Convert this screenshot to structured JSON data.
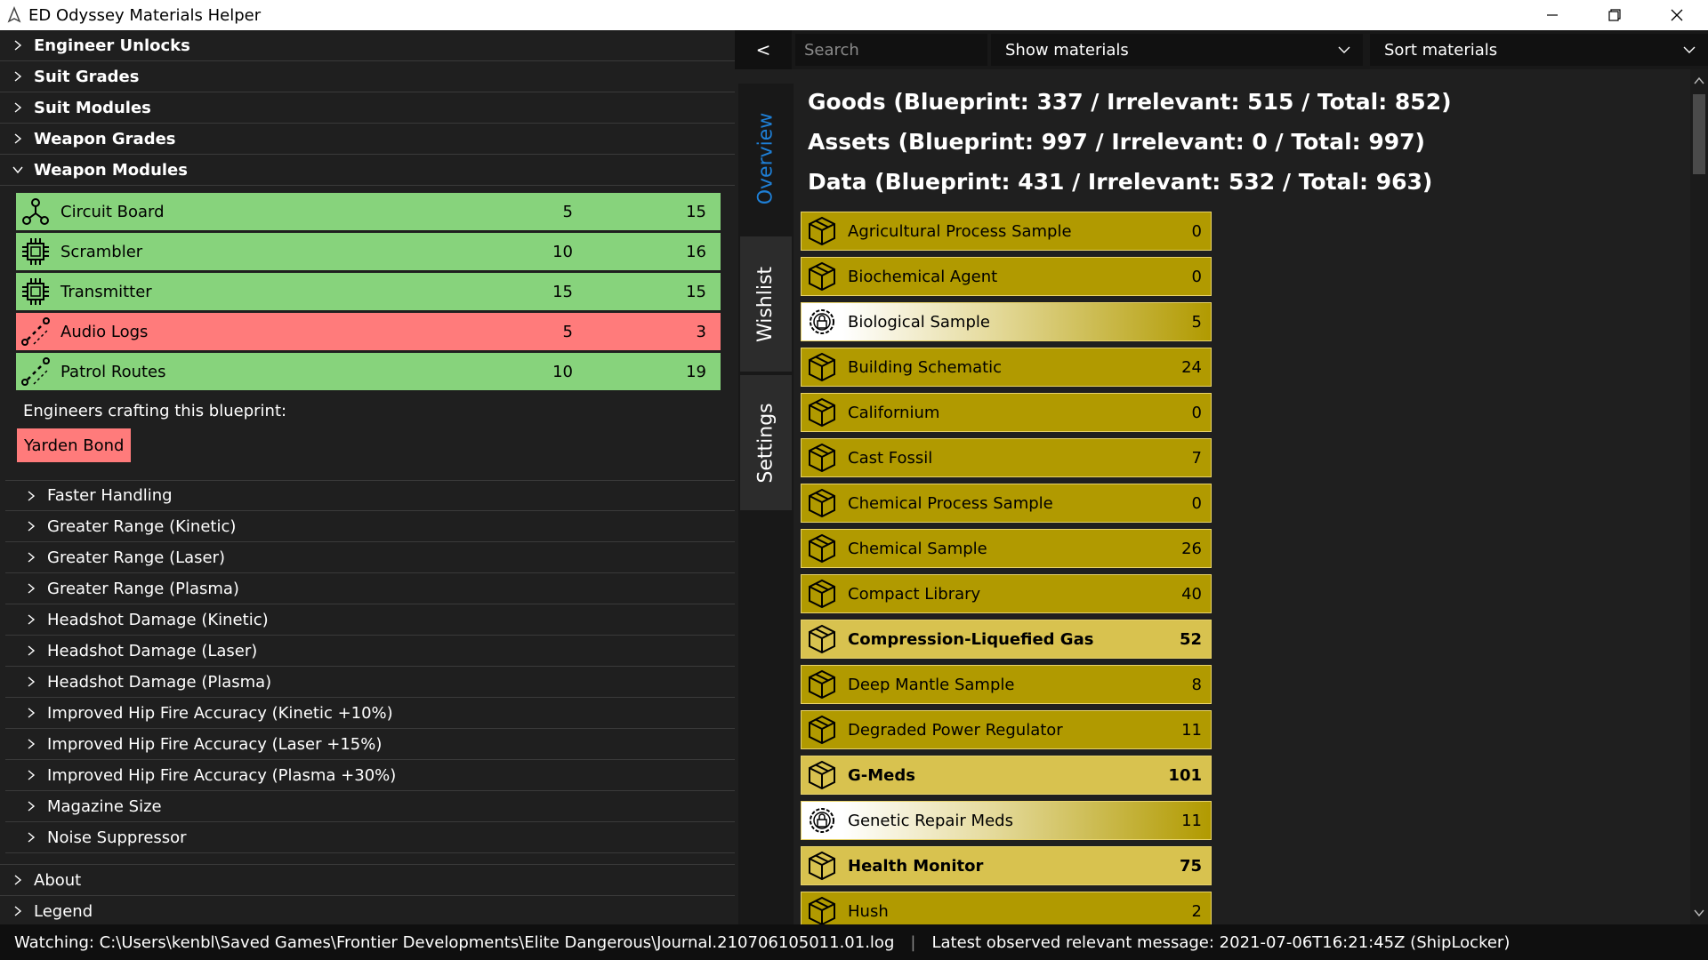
{
  "window": {
    "title": "ED Odyssey Materials Helper"
  },
  "left_panel": {
    "sections": [
      {
        "label": "Engineer Unlocks",
        "expanded": false
      },
      {
        "label": "Suit Grades",
        "expanded": false
      },
      {
        "label": "Suit Modules",
        "expanded": false
      },
      {
        "label": "Weapon Grades",
        "expanded": false
      },
      {
        "label": "Weapon Modules",
        "expanded": true
      }
    ],
    "blueprint_materials": [
      {
        "name": "Circuit Board",
        "icon": "circuit-icon",
        "required": "5",
        "owned": "15",
        "status": "ok"
      },
      {
        "name": "Scrambler",
        "icon": "chip-icon",
        "required": "10",
        "owned": "16",
        "status": "ok"
      },
      {
        "name": "Transmitter",
        "icon": "chip-icon",
        "required": "15",
        "owned": "15",
        "status": "ok"
      },
      {
        "name": "Audio Logs",
        "icon": "data-icon",
        "required": "5",
        "owned": "3",
        "status": "missing"
      },
      {
        "name": "Patrol Routes",
        "icon": "data-icon",
        "required": "10",
        "owned": "19",
        "status": "ok"
      }
    ],
    "engineers_label": "Engineers crafting this blueprint:",
    "engineer": "Yarden Bond",
    "subsections": [
      "Faster Handling",
      "Greater Range (Kinetic)",
      "Greater Range (Laser)",
      "Greater Range (Plasma)",
      "Headshot Damage (Kinetic)",
      "Headshot Damage (Laser)",
      "Headshot Damage (Plasma)",
      "Improved Hip Fire Accuracy (Kinetic +10%)",
      "Improved Hip Fire Accuracy (Laser +15%)",
      "Improved Hip Fire Accuracy (Plasma +30%)",
      "Magazine Size",
      "Noise Suppressor"
    ],
    "bottom_sections": [
      "About",
      "Legend"
    ]
  },
  "toolbar": {
    "back_label": "<",
    "search_placeholder": "Search",
    "filter_label": "Show materials",
    "sort_label": "Sort materials"
  },
  "tabs": [
    {
      "label": "Overview",
      "active": true
    },
    {
      "label": "Wishlist",
      "active": false
    },
    {
      "label": "Settings",
      "active": false
    }
  ],
  "summary": {
    "goods": "Goods (Blueprint: 337 / Irrelevant: 515 / Total: 852)",
    "assets": "Assets (Blueprint: 997 / Irrelevant: 0 / Total: 997)",
    "data": "Data (Blueprint: 431 / Irrelevant: 532 / Total: 963)"
  },
  "materials": [
    {
      "name": "Agricultural Process Sample",
      "count": "0",
      "style": "normal",
      "icon": "crate-icon"
    },
    {
      "name": "Biochemical Agent",
      "count": "0",
      "style": "normal",
      "icon": "crate-icon"
    },
    {
      "name": "Biological Sample",
      "count": "5",
      "style": "faded",
      "icon": "lock-gear-icon"
    },
    {
      "name": "Building Schematic",
      "count": "24",
      "style": "normal",
      "icon": "crate-icon"
    },
    {
      "name": "Californium",
      "count": "0",
      "style": "normal",
      "icon": "crate-icon"
    },
    {
      "name": "Cast Fossil",
      "count": "7",
      "style": "normal",
      "icon": "crate-icon"
    },
    {
      "name": "Chemical Process Sample",
      "count": "0",
      "style": "normal",
      "icon": "crate-icon"
    },
    {
      "name": "Chemical Sample",
      "count": "26",
      "style": "normal",
      "icon": "crate-icon"
    },
    {
      "name": "Compact Library",
      "count": "40",
      "style": "normal",
      "icon": "crate-icon"
    },
    {
      "name": "Compression-Liquefied Gas",
      "count": "52",
      "style": "bold",
      "icon": "crate-icon"
    },
    {
      "name": "Deep Mantle Sample",
      "count": "8",
      "style": "normal",
      "icon": "crate-icon"
    },
    {
      "name": "Degraded Power Regulator",
      "count": "11",
      "style": "normal",
      "icon": "crate-icon"
    },
    {
      "name": "G-Meds",
      "count": "101",
      "style": "bold",
      "icon": "crate-icon"
    },
    {
      "name": "Genetic Repair Meds",
      "count": "11",
      "style": "faded",
      "icon": "lock-gear-icon"
    },
    {
      "name": "Health Monitor",
      "count": "75",
      "style": "bold",
      "icon": "crate-icon"
    },
    {
      "name": "Hush",
      "count": "2",
      "style": "normal",
      "icon": "crate-icon"
    }
  ],
  "status": {
    "watching": "Watching: C:\\Users\\kenbl\\Saved Games\\Frontier Developments\\Elite Dangerous\\Journal.210706105011.01.log",
    "separator": "|",
    "latest": "Latest observed relevant message: 2021-07-06T16:21:45Z (ShipLocker)"
  }
}
